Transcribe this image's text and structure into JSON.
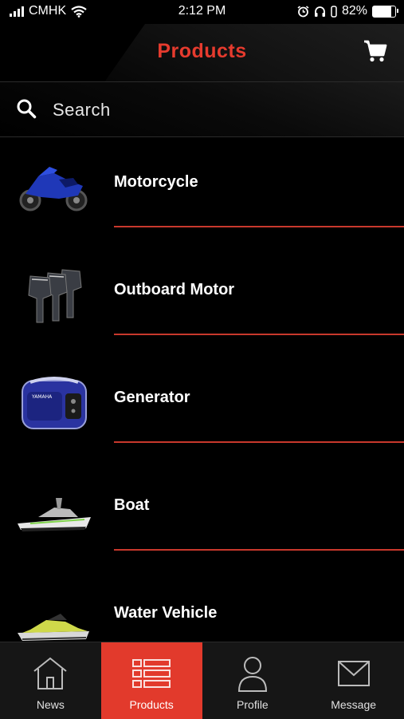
{
  "status_bar": {
    "carrier": "CMHK",
    "time": "2:12 PM",
    "battery": "82%",
    "battery_level": 0.82
  },
  "header": {
    "title": "Products",
    "cart_icon": "shopping-cart-icon",
    "title_color": "#e63b2e"
  },
  "search": {
    "placeholder": "Search",
    "icon": "search-icon"
  },
  "products": [
    {
      "label": "Motorcycle",
      "icon": "motorcycle-thumbnail"
    },
    {
      "label": "Outboard Motor",
      "icon": "outboard-motor-thumbnail"
    },
    {
      "label": "Generator",
      "icon": "generator-thumbnail"
    },
    {
      "label": "Boat",
      "icon": "boat-thumbnail"
    },
    {
      "label": "Water Vehicle",
      "icon": "water-vehicle-thumbnail"
    }
  ],
  "tabs": [
    {
      "label": "News",
      "icon": "house-icon",
      "active": false
    },
    {
      "label": "Products",
      "icon": "list-icon",
      "active": true
    },
    {
      "label": "Profile",
      "icon": "person-icon",
      "active": false
    },
    {
      "label": "Message",
      "icon": "envelope-icon",
      "active": false
    }
  ],
  "colors": {
    "accent": "#e23a2c",
    "divider": "#c8382c",
    "background": "#000000"
  }
}
